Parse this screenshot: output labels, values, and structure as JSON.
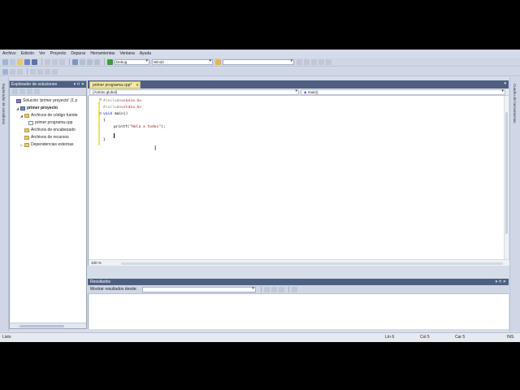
{
  "menu": [
    "Archivo",
    "Edición",
    "Ver",
    "Proyecto",
    "Depurar",
    "Herramientas",
    "Ventana",
    "Ayuda"
  ],
  "toolbar": {
    "config": "Debug",
    "platform": "Win32",
    "search": ""
  },
  "left_strip": {
    "label": "Explorador de servidores"
  },
  "right_strip": {
    "label": "Cuadro de herramientas"
  },
  "solution_explorer": {
    "title": "Explorador de soluciones",
    "buttons": "▾ ⊓ ✕",
    "items": [
      {
        "label": "Solución 'primer proyecto' (1 p",
        "kind": "sol",
        "indent": 0,
        "arrow": ""
      },
      {
        "label": "primer proyecto",
        "kind": "proj",
        "indent": 1,
        "arrow": "◢"
      },
      {
        "label": "Archivos de código fuente",
        "kind": "folder",
        "indent": 2,
        "arrow": "◢"
      },
      {
        "label": "primer programa.cpp",
        "kind": "file",
        "indent": 3,
        "arrow": ""
      },
      {
        "label": "Archivos de encabezado",
        "kind": "folder",
        "indent": 2,
        "arrow": ""
      },
      {
        "label": "Archivos de recursos",
        "kind": "folder",
        "indent": 2,
        "arrow": ""
      },
      {
        "label": "Dependencias externas",
        "kind": "folder",
        "indent": 2,
        "arrow": "▷"
      }
    ]
  },
  "editor": {
    "tab_label": "primer programa.cpp*",
    "tab_close": "x",
    "scope": "(Ámbito global)",
    "function": "main()",
    "zoom": "100 %",
    "code": {
      "line1_pp": "#include",
      "line1_inc": "<conio.h>",
      "line2_pp": "#include",
      "line2_inc": "<stdio.h>",
      "line3_kw": "void",
      "line3_rest": " main()",
      "line4": "{",
      "line5_fn": "printf(",
      "line5_str": "\"Hola a todos\"",
      "line5_end": ");",
      "line7": "}"
    }
  },
  "output": {
    "title": "Resultados",
    "buttons": "▾ ⊓ ✕",
    "show_from_label": "Mostrar resultados desde:",
    "show_from_value": ""
  },
  "statusbar": {
    "ready": "Listo",
    "line": "Lín 6",
    "col": "Col 5",
    "char": "Car 5",
    "ins": "INS"
  }
}
